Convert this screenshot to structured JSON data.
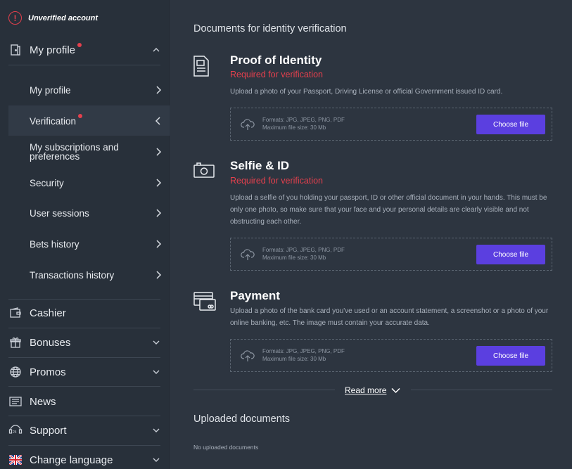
{
  "account": {
    "status": "Unverified account"
  },
  "sidebar": {
    "my_profile": {
      "label": "My profile"
    },
    "submenu": [
      {
        "label": "My profile"
      },
      {
        "label": "Verification"
      },
      {
        "label": "My subscriptions and preferences"
      },
      {
        "label": "Security"
      },
      {
        "label": "User sessions"
      },
      {
        "label": "Bets history"
      },
      {
        "label": "Transactions history"
      }
    ],
    "items": [
      {
        "label": "Cashier"
      },
      {
        "label": "Bonuses"
      },
      {
        "label": "Promos"
      },
      {
        "label": "News"
      },
      {
        "label": "Support"
      },
      {
        "label": "Change language"
      }
    ]
  },
  "main": {
    "title": "Documents for identity verification",
    "documents": [
      {
        "title": "Proof of Identity",
        "required": "Required for verification",
        "description": "Upload a photo of your Passport, Driving License or official Government issued ID card.",
        "formats": "Formats: JPG, JPEG, PNG, PDF",
        "max_size": "Maximum file size: 30 Mb",
        "button": "Choose file"
      },
      {
        "title": "Selfie & ID",
        "required": "Required for verification",
        "description": "Upload a selfie of you holding your passport, ID or other official document in your hands. This must be only one photo, so make sure that your face and your personal details are clearly visible and not obstructing each other.",
        "formats": "Formats: JPG, JPEG, PNG, PDF",
        "max_size": "Maximum file size: 30 Mb",
        "button": "Choose file"
      },
      {
        "title": "Payment",
        "description": "Upload a photo of the bank card you've used or an account statement, a screenshot or a photo of your online banking, etc. The image must contain your accurate data.",
        "formats": "Formats: JPG, JPEG, PNG, PDF",
        "max_size": "Maximum file size: 30 Mb",
        "button": "Choose file"
      }
    ],
    "read_more": "Read more",
    "uploaded_title": "Uploaded documents",
    "no_uploaded": "No uploaded documents"
  },
  "colors": {
    "accent": "#5b3fe0",
    "alert": "#e5404d",
    "sidebar_bg": "#28303a",
    "main_bg": "#2d3540"
  }
}
